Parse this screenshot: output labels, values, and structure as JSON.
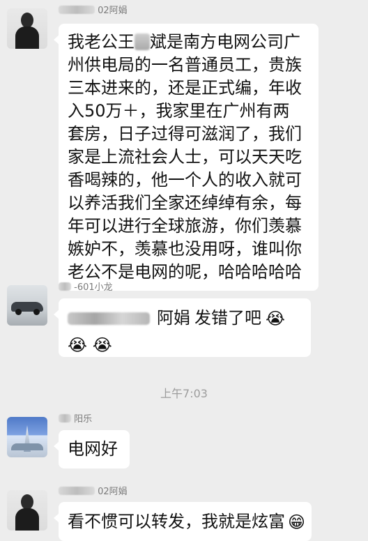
{
  "chat": {
    "messages": [
      {
        "sender": {
          "visible_name": "02阿娟"
        },
        "avatar_icon": "woman-avatar-icon",
        "lines": [
          "我老公王",
          "斌是南方电网公司广",
          "州供电局的一名普通员工，贵族",
          "三本进来的，还是正式编，年收",
          "入50万＋，我家里在广州有两",
          "套房，日子过得可滋润了，我们",
          "家是上流社会人士，可以天天吃",
          "香喝辣的，他一个人的收入就可",
          "以养活我们全家还绰绰有余，每",
          "年可以进行全球旅游，你们羡慕",
          "嫉妒不，羡慕也没用呀，谁叫你",
          "老公不是电网的呢，哈哈哈哈哈"
        ]
      },
      {
        "sender": {
          "visible_name": "-601小龙"
        },
        "avatar_icon": "car-avatar-icon",
        "mention_name": "阿娟",
        "text": "发错了吧",
        "emoji": "😭"
      },
      {
        "sender": {
          "visible_name": "阳乐"
        },
        "avatar_icon": "city-avatar-icon",
        "text": "电网好"
      },
      {
        "sender": {
          "visible_name": "02阿娟"
        },
        "avatar_icon": "woman-avatar-icon",
        "text": "看不惯可以转发，我就是炫富",
        "emoji": "😁"
      }
    ],
    "timestamp": "上午7:03"
  }
}
